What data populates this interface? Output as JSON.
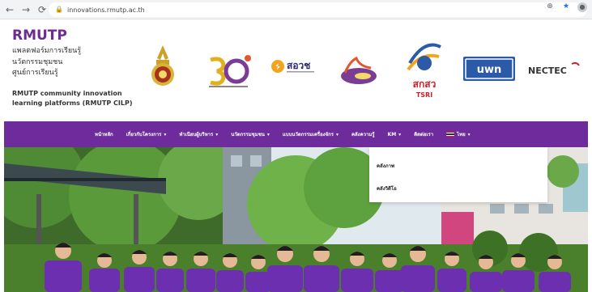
{
  "browser": {
    "url": "innovations.rmutp.ac.th",
    "back_icon": "back-arrow-icon",
    "forward_icon": "forward-arrow-icon",
    "reload_icon": "reload-icon",
    "lock_icon": "lock-icon",
    "zoom_icon": "zoom-icon",
    "star_icon": "star-icon",
    "profile_icon": "profile-icon"
  },
  "header": {
    "brand_title": "RMUTP",
    "brand_lines": [
      "แพลตฟอร์มการเรียนรู้",
      "นวัตกรรมชุมชน",
      "ศูนย์การเรียนรู้"
    ],
    "brand_english_line1": "RMUTP community innovation",
    "brand_english_line2": "learning platforms (RMUTP CILP)",
    "logos": [
      {
        "name": "rmutp-emblem-logo"
      },
      {
        "name": "30-anniversary-logo"
      },
      {
        "name": "sorsor-logo",
        "text": "สอวช"
      },
      {
        "name": "vru-logo"
      },
      {
        "name": "tsri-logo",
        "text": "สกสว",
        "text2": "TSRI"
      },
      {
        "name": "bwn-logo",
        "text": "uwn"
      },
      {
        "name": "nectec-logo",
        "text": "NECTEC"
      }
    ]
  },
  "nav": {
    "items": [
      {
        "label": "หน้าหลัก",
        "has_caret": false
      },
      {
        "label": "เกี่ยวกับโครงการ",
        "has_caret": true
      },
      {
        "label": "ทำเนียบผู้บริหาร",
        "has_caret": true
      },
      {
        "label": "นวัตกรรมชุมชน",
        "has_caret": true
      },
      {
        "label": "แบบนวัตกรรมเครื่องจักร",
        "has_caret": true
      },
      {
        "label": "คลังความรู้",
        "has_caret": false
      },
      {
        "label": "KM",
        "has_caret": true
      },
      {
        "label": "ติดต่อเรา",
        "has_caret": false
      },
      {
        "label": "ไทย",
        "has_caret": true
      }
    ],
    "color": "#6d2b9b"
  },
  "dropdown": {
    "items": [
      "คลังภาพ",
      "คลังวิดีโอ"
    ]
  }
}
